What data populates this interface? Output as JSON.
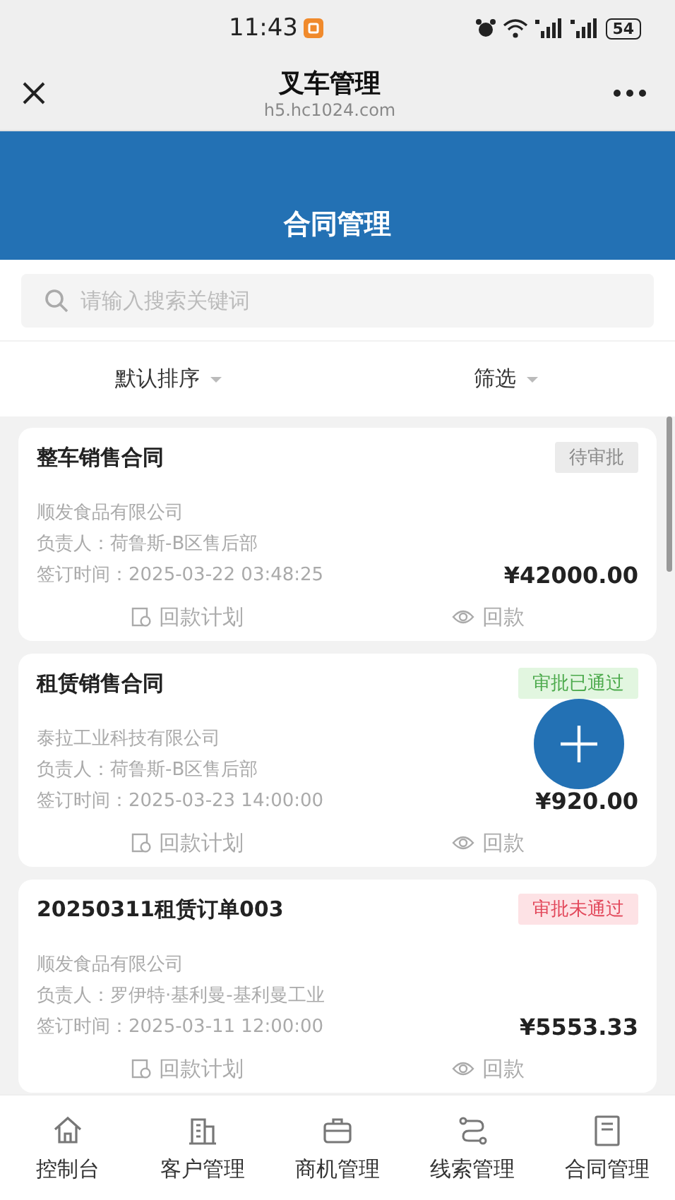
{
  "status_bar": {
    "time": "11:43",
    "battery": "54"
  },
  "browser_bar": {
    "title": "叉车管理",
    "url": "h5.hc1024.com"
  },
  "banner": {
    "title": "合同管理"
  },
  "search": {
    "placeholder": "请输入搜索关键词"
  },
  "filters": [
    {
      "label": "默认排序"
    },
    {
      "label": "筛选"
    }
  ],
  "contracts": [
    {
      "title": "整车销售合同",
      "status": {
        "label": "待审批",
        "kind": "pending"
      },
      "customer": "顺发食品有限公司",
      "owner": "负责人：荷鲁斯-B区售后部",
      "signed": "签订时间：2025-03-22 03:48:25",
      "amount": "¥42000.00",
      "actions": [
        "回款计划",
        "回款"
      ]
    },
    {
      "title": "租赁销售合同",
      "status": {
        "label": "审批已通过",
        "kind": "approved"
      },
      "customer": "泰拉工业科技有限公司",
      "owner": "负责人：荷鲁斯-B区售后部",
      "signed": "签订时间：2025-03-23 14:00:00",
      "amount": "¥920.00",
      "actions": [
        "回款计划",
        "回款"
      ]
    },
    {
      "title": "20250311租赁订单003",
      "status": {
        "label": "审批未通过",
        "kind": "rejected"
      },
      "customer": "顺发食品有限公司",
      "owner": "负责人：罗伊特·基利曼-基利曼工业",
      "signed": "签订时间：2025-03-11 12:00:00",
      "amount": "¥5553.33",
      "actions": [
        "回款计划",
        "回款"
      ]
    }
  ],
  "tabs": [
    {
      "label": "控制台",
      "selected": false
    },
    {
      "label": "客户管理",
      "selected": false
    },
    {
      "label": "商机管理",
      "selected": false
    },
    {
      "label": "线索管理",
      "selected": false
    },
    {
      "label": "合同管理",
      "selected": false
    }
  ]
}
